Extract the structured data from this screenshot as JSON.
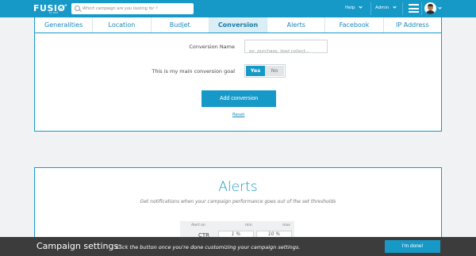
{
  "header": {
    "logo_text": "FUSIO",
    "logo_sub": "by S4M",
    "search_placeholder": "Which campaign are you looking for ?",
    "help_label": "Help",
    "admin_label": "Admin"
  },
  "tabs": [
    {
      "label": "Generalities",
      "active": false
    },
    {
      "label": "Location",
      "active": false
    },
    {
      "label": "Budjet",
      "active": false
    },
    {
      "label": "Conversion",
      "active": true
    },
    {
      "label": "Alerts",
      "active": false
    },
    {
      "label": "Facebook",
      "active": false
    },
    {
      "label": "IP Address",
      "active": false
    }
  ],
  "conversion": {
    "name_label": "Conversion Name",
    "name_placeholder": "ex: purchase, lead collect...",
    "main_goal_label": "This is my main conversion goal",
    "toggle_yes": "Yes",
    "toggle_no": "No",
    "toggle_selected": "Yes",
    "add_button": "Add conversion",
    "reset_link": "Reset"
  },
  "alerts": {
    "title": "Alerts",
    "subtitle": "Get notifications when your campaign performance goes out of the set thresholds",
    "table": {
      "col_alert_on": "Alert on",
      "col_min": "min.",
      "col_max": "max",
      "row_label": "CTR",
      "min_value": "1 %",
      "max_value": "10 %"
    }
  },
  "footer": {
    "title": "Campaign settings:",
    "description": "Click the button once you're done customizing your campaign settings.",
    "done_button": "I'm done!"
  },
  "colors": {
    "accent": "#1799c8",
    "footer_bg": "#3c3c3c",
    "page_bg": "#f0f2f4"
  }
}
